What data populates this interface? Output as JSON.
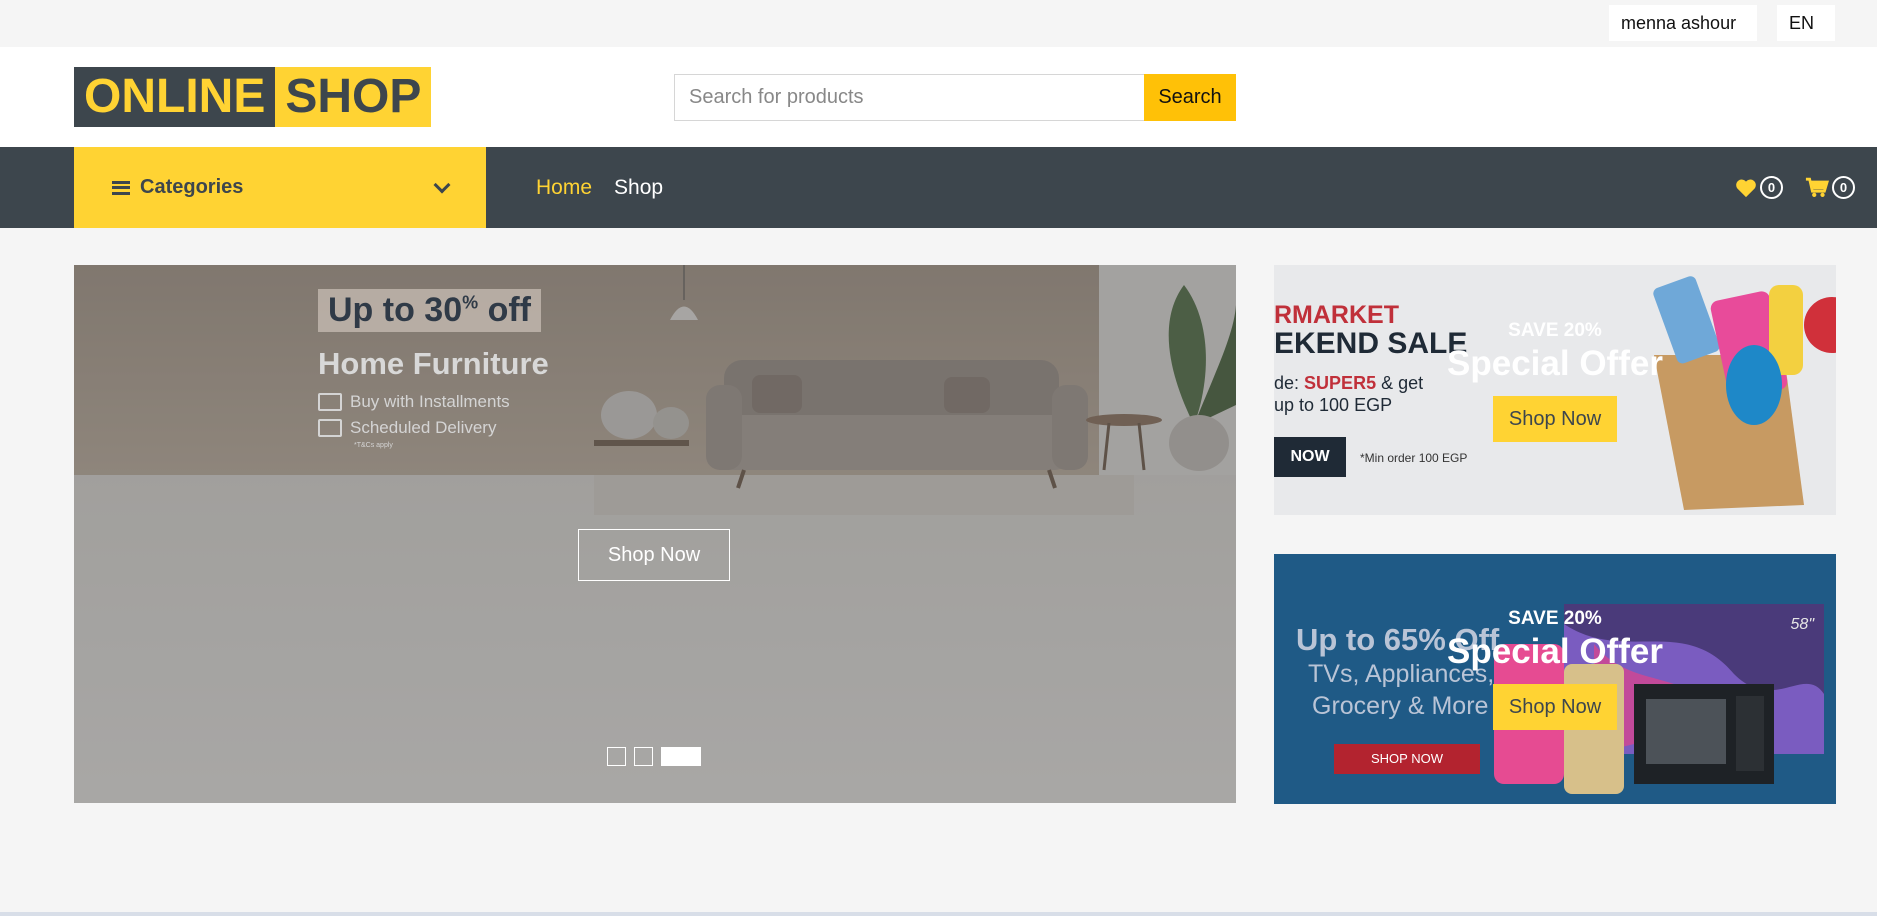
{
  "topbar": {
    "user": "menna ashour",
    "language": "EN"
  },
  "header": {
    "logo_part1": "ONLINE",
    "logo_part2": "SHOP",
    "search_placeholder": "Search for products",
    "search_button": "Search"
  },
  "nav": {
    "categories_label": "Categories",
    "links": [
      {
        "label": "Home",
        "active": true
      },
      {
        "label": "Shop",
        "active": false
      }
    ],
    "wishlist_count": "0",
    "cart_count": "0"
  },
  "carousel": {
    "banner_tag": "Up to 30",
    "banner_tag_sup": "%",
    "banner_tag_suffix": " off",
    "banner_title": "Home Furniture",
    "banner_line1": "Buy with Installments",
    "banner_line2": "Scheduled Delivery",
    "banner_terms": "*T&Cs apply",
    "button": "Shop Now",
    "slides": 3,
    "active_slide": 3
  },
  "offers": [
    {
      "save": "SAVE 20%",
      "title": "Special Offer",
      "button": "Shop Now",
      "bg_text1": "RMARKET",
      "bg_text2": "EKEND SALE",
      "bg_text3": "de:",
      "bg_code": "SUPER5",
      "bg_text4": "& get",
      "bg_text5": "up to 100 EGP",
      "bg_button": "NOW",
      "bg_note": "*Min order 100 EGP"
    },
    {
      "save": "SAVE 20%",
      "title": "Special Offer",
      "button": "Shop Now",
      "bg_text1": "Up to 65% Off",
      "bg_text2": "TVs, Appliances,",
      "bg_text3": "Grocery & More",
      "bg_button": "SHOP NOW",
      "bg_size": "58\""
    }
  ],
  "colors": {
    "primary": "#ffd333",
    "dark": "#3d464d"
  }
}
